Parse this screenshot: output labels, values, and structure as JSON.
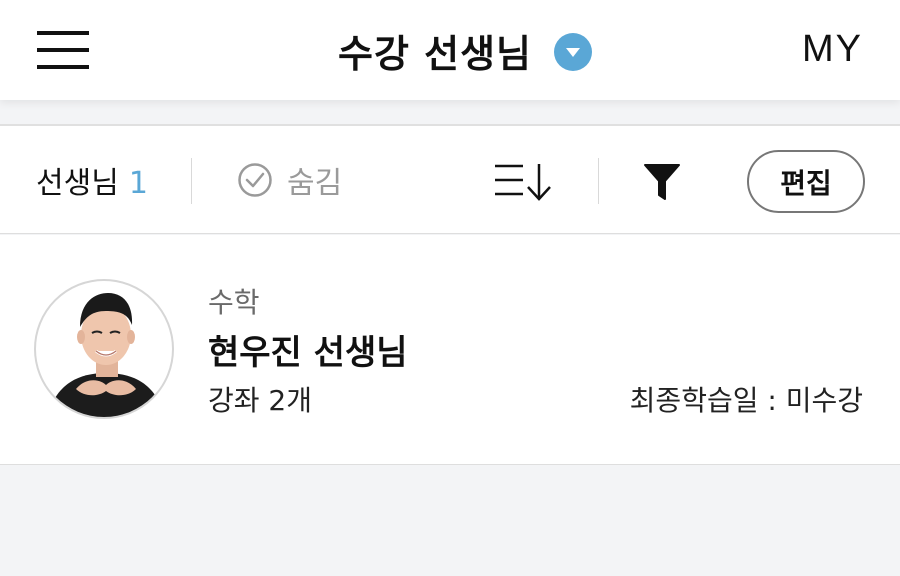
{
  "header": {
    "title": "수강 선생님",
    "my_label": "MY"
  },
  "toolbar": {
    "teachers_label": "선생님",
    "teachers_count": "1",
    "hidden_label": "숨김",
    "edit_label": "편집"
  },
  "teachers": [
    {
      "subject": "수학",
      "name": "현우진 선생님",
      "courses": "강좌 2개",
      "last_study": "최종학습일 : 미수강"
    }
  ],
  "colors": {
    "accent": "#5aa7d6",
    "page_background": "#f3f4f6"
  },
  "icons": [
    "menu-icon",
    "dropdown-icon",
    "check-circle-icon",
    "sort-icon",
    "filter-icon"
  ]
}
